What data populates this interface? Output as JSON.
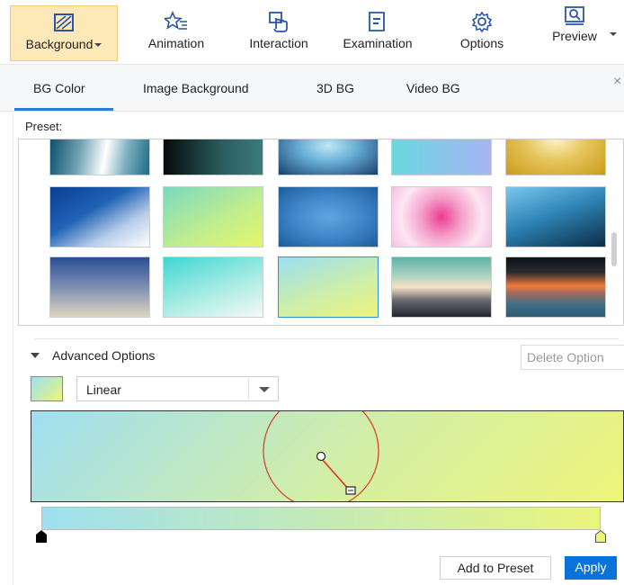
{
  "toolbar": {
    "items": [
      {
        "label": "Background",
        "icon": "background-icon",
        "active": true
      },
      {
        "label": "Animation",
        "icon": "animation-star-icon"
      },
      {
        "label": "Interaction",
        "icon": "interaction-hand-icon"
      },
      {
        "label": "Examination",
        "icon": "examination-doc-icon"
      },
      {
        "label": "Options",
        "icon": "options-gear-icon"
      },
      {
        "label": "Preview",
        "icon": "preview-icon"
      }
    ]
  },
  "tabs": {
    "items": [
      "BG Color",
      "Image Background",
      "3D BG",
      "Video BG"
    ],
    "active": "BG Color",
    "close_glyph": "×"
  },
  "preset": {
    "label": "Preset:",
    "swatches": [
      {
        "name": "teal-white-sheen",
        "colors": [
          "#0d4f6e",
          "#ffffff",
          "#1c6b86"
        ]
      },
      {
        "name": "black-teal",
        "colors": [
          "#050a0a",
          "#3a7c7c"
        ]
      },
      {
        "name": "blue-glow",
        "colors": [
          "#aee0f2",
          "#17406e"
        ]
      },
      {
        "name": "cyan-lavender",
        "colors": [
          "#6ad9df",
          "#a6b5f5"
        ]
      },
      {
        "name": "gold-glow",
        "colors": [
          "#fff4c8",
          "#c99b1c"
        ]
      },
      {
        "name": "blue-white-diagonal",
        "colors": [
          "#0b3d91",
          "#ffffff"
        ]
      },
      {
        "name": "mint-lime",
        "colors": [
          "#7ad9c1",
          "#e2f76a"
        ]
      },
      {
        "name": "blue-radial",
        "colors": [
          "#5fa5e0",
          "#1d5c9a"
        ]
      },
      {
        "name": "pink-radial",
        "colors": [
          "#ec3b8e",
          "#fde6f3"
        ]
      },
      {
        "name": "ocean-blue",
        "colors": [
          "#7cc7ee",
          "#0b2b47"
        ]
      },
      {
        "name": "navy-sand",
        "colors": [
          "#2a4e94",
          "#ded6c0"
        ]
      },
      {
        "name": "cyan-white",
        "colors": [
          "#3fd7d2",
          "#f5f9f4"
        ]
      },
      {
        "name": "sky-lime-selected",
        "colors": [
          "#9adef2",
          "#eef47a"
        ],
        "selected": true
      },
      {
        "name": "sunset-horizon",
        "colors": [
          "#5fb3a8",
          "#f6e2c5",
          "#1f2630"
        ]
      },
      {
        "name": "dusk-orange",
        "colors": [
          "#0a1218",
          "#f07a3a",
          "#3c6f86"
        ]
      }
    ]
  },
  "advanced": {
    "label": "Advanced Options",
    "delete_label": "Delete Option",
    "gradient_type": "Linear",
    "add_to_preset": "Add to Preset",
    "apply": "Apply",
    "colors": {
      "start": "#9ee0f1",
      "end": "#eaf57c",
      "handle": "#d9362b",
      "accent": "#0a73d9"
    }
  }
}
